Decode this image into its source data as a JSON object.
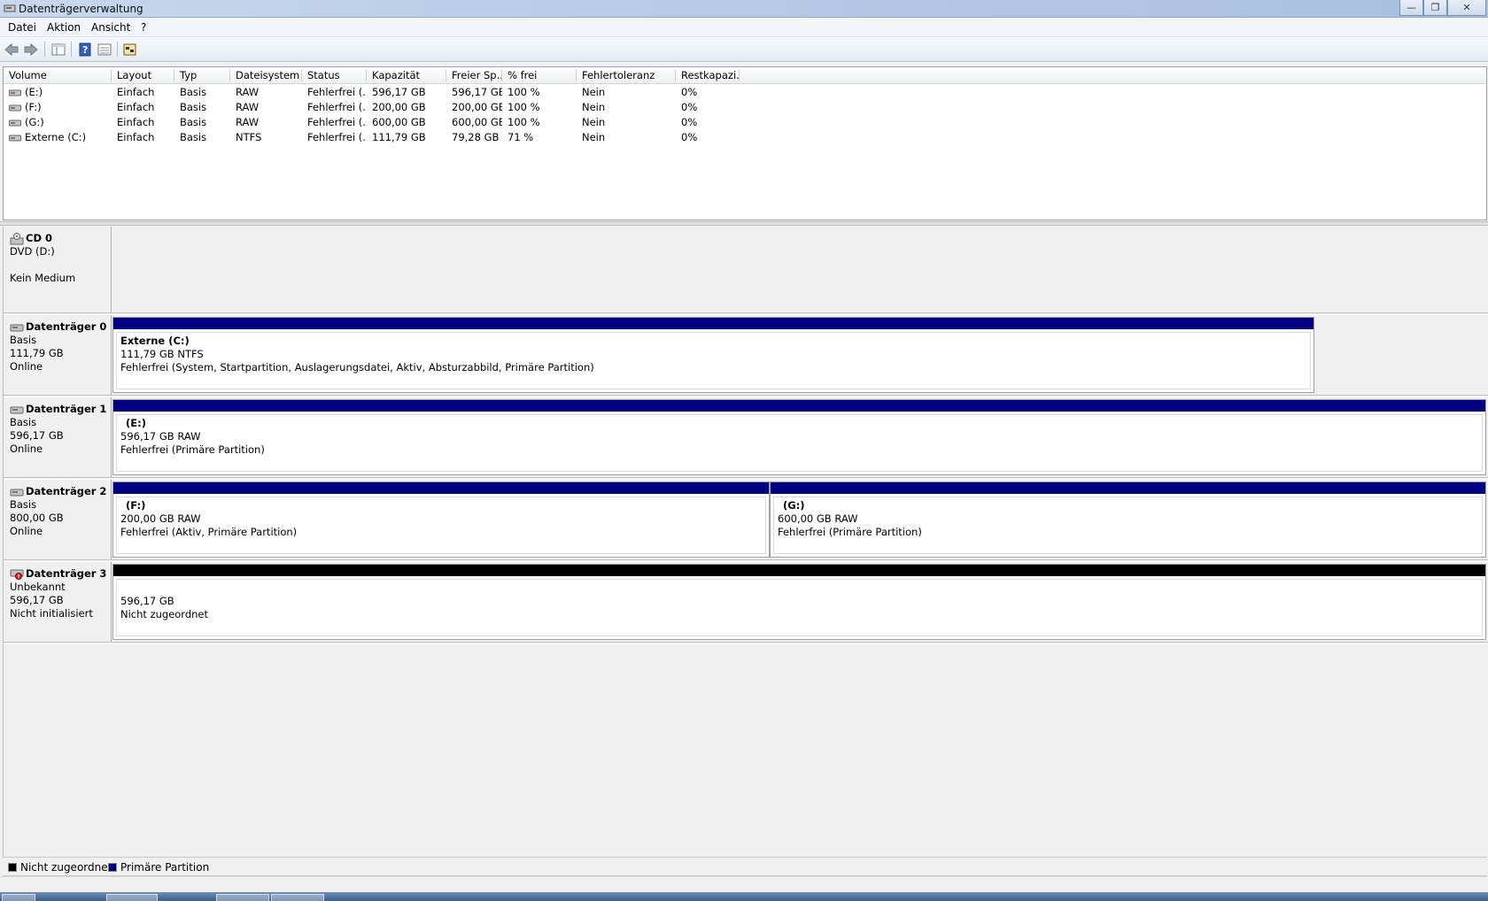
{
  "window": {
    "title": "Datenträgerverwaltung",
    "buttons": {
      "minimize": "—",
      "restore": "❐",
      "close": "✕"
    }
  },
  "menu": [
    "Datei",
    "Aktion",
    "Ansicht",
    "?"
  ],
  "toolbar": [
    "back-icon",
    "forward-icon",
    "console-tree-icon",
    "help-icon",
    "list-view-icon",
    "properties-icon"
  ],
  "volume_table": {
    "columns": [
      "Volume",
      "Layout",
      "Typ",
      "Dateisystem",
      "Status",
      "Kapazität",
      "Freier Sp...",
      "% frei",
      "Fehlertoleranz",
      "Restkapazi..."
    ],
    "rows": [
      [
        "(E:)",
        "Einfach",
        "Basis",
        "RAW",
        "Fehlerfrei (...",
        "596,17 GB",
        "596,17 GB",
        "100 %",
        "Nein",
        "0%"
      ],
      [
        "(F:)",
        "Einfach",
        "Basis",
        "RAW",
        "Fehlerfrei (...",
        "200,00 GB",
        "200,00 GB",
        "100 %",
        "Nein",
        "0%"
      ],
      [
        "(G:)",
        "Einfach",
        "Basis",
        "RAW",
        "Fehlerfrei (...",
        "600,00 GB",
        "600,00 GB",
        "100 %",
        "Nein",
        "0%"
      ],
      [
        "Externe (C:)",
        "Einfach",
        "Basis",
        "NTFS",
        "Fehlerfrei (...",
        "111,79 GB",
        "79,28 GB",
        "71 %",
        "Nein",
        "0%"
      ]
    ]
  },
  "disks": {
    "cd0": {
      "name": "CD 0",
      "line1": "DVD (D:)",
      "line2": "Kein Medium"
    },
    "d0": {
      "name": "Datenträger 0",
      "type": "Basis",
      "size": "111,79 GB",
      "status": "Online",
      "part": {
        "title": "Externe  (C:)",
        "size": "111,79 GB NTFS",
        "status": "Fehlerfrei (System, Startpartition, Auslagerungsdatei, Aktiv, Absturzabbild, Primäre Partition)"
      }
    },
    "d1": {
      "name": "Datenträger 1",
      "type": "Basis",
      "size": "596,17 GB",
      "status": "Online",
      "part": {
        "title": "(E:)",
        "size": "596,17 GB RAW",
        "status": "Fehlerfrei (Primäre Partition)"
      }
    },
    "d2": {
      "name": "Datenträger 2",
      "type": "Basis",
      "size": "800,00 GB",
      "status": "Online",
      "part1": {
        "title": "(F:)",
        "size": "200,00 GB RAW",
        "status": "Fehlerfrei (Aktiv, Primäre Partition)"
      },
      "part2": {
        "title": "(G:)",
        "size": "600,00 GB RAW",
        "status": "Fehlerfrei (Primäre Partition)"
      }
    },
    "d3": {
      "name": "Datenträger 3",
      "type": "Unbekannt",
      "size": "596,17 GB",
      "status": "Nicht initialisiert",
      "part": {
        "size": "596,17 GB",
        "status": "Nicht zugeordnet"
      }
    }
  },
  "legend": {
    "unallocated": "Nicht zugeordnet",
    "unallocated_color": "#000000",
    "primary": "Primäre Partition",
    "primary_color": "#000080"
  }
}
